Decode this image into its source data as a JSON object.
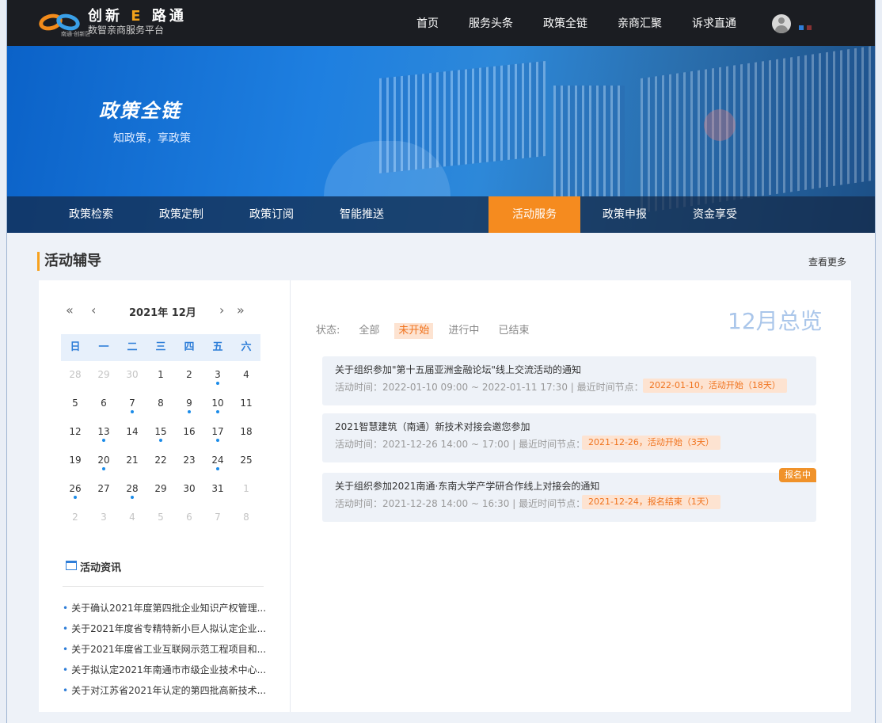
{
  "header": {
    "logo_title_pre": "创新",
    "logo_title_e": "E",
    "logo_title_post": "路通",
    "logo_subtitle": "数智亲商服务平台",
    "logo_region": "南通·创新区",
    "nav": [
      "首页",
      "服务头条",
      "政策全链",
      "亲商汇聚",
      "诉求直通"
    ]
  },
  "banner": {
    "title": "政策全链",
    "subtitle": "知政策，享政策",
    "tabs": [
      "政策检索",
      "政策定制",
      "政策订阅",
      "智能推送",
      "活动服务",
      "政策申报",
      "资金享受"
    ],
    "active_tab": "活动服务"
  },
  "section": {
    "title": "活动辅导",
    "more": "查看更多"
  },
  "calendar": {
    "year_month": "2021年 12月",
    "weekdays": [
      "日",
      "一",
      "二",
      "三",
      "四",
      "五",
      "六"
    ],
    "weeks": [
      [
        {
          "d": "28",
          "m": true
        },
        {
          "d": "29",
          "m": true
        },
        {
          "d": "30",
          "m": true
        },
        {
          "d": "1"
        },
        {
          "d": "2"
        },
        {
          "d": "3",
          "dot": true
        },
        {
          "d": "4"
        }
      ],
      [
        {
          "d": "5"
        },
        {
          "d": "6"
        },
        {
          "d": "7",
          "dot": true
        },
        {
          "d": "8"
        },
        {
          "d": "9",
          "dot": true
        },
        {
          "d": "10",
          "dot": true
        },
        {
          "d": "11"
        }
      ],
      [
        {
          "d": "12"
        },
        {
          "d": "13",
          "dot": true
        },
        {
          "d": "14"
        },
        {
          "d": "15",
          "dot": true
        },
        {
          "d": "16"
        },
        {
          "d": "17",
          "dot": true
        },
        {
          "d": "18"
        }
      ],
      [
        {
          "d": "19"
        },
        {
          "d": "20",
          "dot": true
        },
        {
          "d": "21"
        },
        {
          "d": "22"
        },
        {
          "d": "23"
        },
        {
          "d": "24",
          "dot": true
        },
        {
          "d": "25"
        }
      ],
      [
        {
          "d": "26",
          "dot": true
        },
        {
          "d": "27"
        },
        {
          "d": "28",
          "dot": true
        },
        {
          "d": "29"
        },
        {
          "d": "30"
        },
        {
          "d": "31"
        },
        {
          "d": "1",
          "m": true
        }
      ],
      [
        {
          "d": "2",
          "m": true
        },
        {
          "d": "3",
          "m": true
        },
        {
          "d": "4",
          "m": true
        },
        {
          "d": "5",
          "m": true
        },
        {
          "d": "6",
          "m": true
        },
        {
          "d": "7",
          "m": true
        },
        {
          "d": "8",
          "m": true
        }
      ]
    ]
  },
  "news": {
    "title": "活动资讯",
    "items": [
      "关于确认2021年度第四批企业知识产权管理...",
      "关于2021年度省专精特新小巨人拟认定企业...",
      "关于2021年度省工业互联网示范工程项目和...",
      "关于拟认定2021年南通市市级企业技术中心...",
      "关于对江苏省2021年认定的第四批高新技术..."
    ]
  },
  "overview": {
    "title": "12月总览",
    "status_label": "状态:",
    "statuses": [
      "全部",
      "未开始",
      "进行中",
      "已结束"
    ],
    "active_status": "未开始"
  },
  "activities": [
    {
      "title": "关于组织参加\"第十五届亚洲金融论坛\"线上交流活动的通知",
      "meta": "活动时间：2022-01-10 09:00 ~ 2022-01-11 17:30 | 最近时间节点：",
      "tag": "2022-01-10，活动开始（18天）",
      "badge": ""
    },
    {
      "title": "2021智慧建筑（南通）新技术对接会邀您参加",
      "meta": "活动时间：2021-12-26 14:00 ~ 17:00 | 最近时间节点：",
      "tag": "2021-12-26，活动开始（3天）",
      "badge": ""
    },
    {
      "title": "关于组织参加2021南通·东南大学产学研合作线上对接会的通知",
      "meta": "活动时间：2021-12-28 14:00 ~ 16:30 | 最近时间节点：",
      "tag": "2021-12-24，报名结束（1天）",
      "badge": "报名中"
    }
  ],
  "colors": {
    "accent": "#f58b1f",
    "link_blue": "#2f7ed8",
    "topbar": "#1b1d22"
  }
}
